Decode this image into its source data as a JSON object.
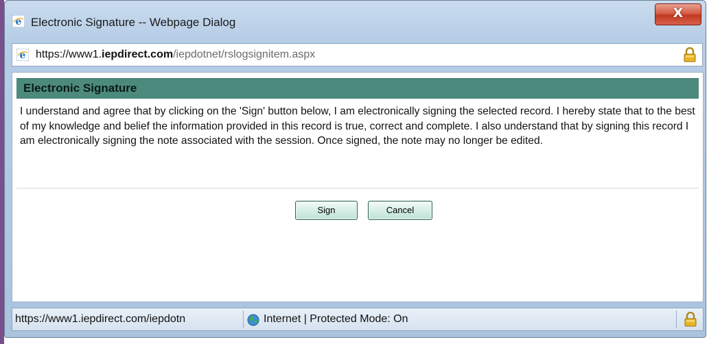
{
  "window": {
    "title": "Electronic Signature -- Webpage Dialog",
    "close_glyph": "X"
  },
  "address": {
    "protocol": "https://www1.",
    "domain": "iepdirect.com",
    "path": "/iepdotnet/rslogsignitem.aspx"
  },
  "dialog": {
    "header": "Electronic Signature",
    "message": "I understand and agree that by clicking on the 'Sign' button below, I am electronically signing the selected record. I hereby state that to the best of my knowledge and belief the information provided in this record is true, correct and complete. I also understand that by signing this record I am electronically signing the note associated with the session. Once signed, the note may no longer be edited.",
    "sign_label": "Sign",
    "cancel_label": "Cancel"
  },
  "status": {
    "url": "https://www1.iepdirect.com/iepdotn",
    "zone": "Internet | Protected Mode: On"
  },
  "icons": {
    "browser": "ie-icon",
    "lock": "lock-icon",
    "globe": "globe-icon"
  },
  "colors": {
    "header_bar": "#4c8a7d",
    "close_button": "#c23a22",
    "button_fill": "#d6eee6"
  }
}
